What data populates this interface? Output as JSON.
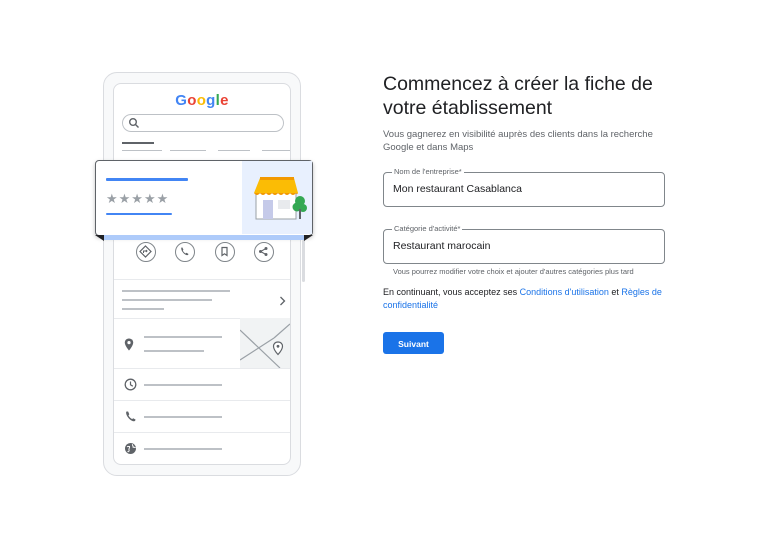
{
  "illustration": {
    "logo_letters": [
      {
        "char": "G",
        "color": "#4285f4"
      },
      {
        "char": "o",
        "color": "#ea4335"
      },
      {
        "char": "o",
        "color": "#fbbc05"
      },
      {
        "char": "g",
        "color": "#4285f4"
      },
      {
        "char": "l",
        "color": "#34a853"
      },
      {
        "char": "e",
        "color": "#ea4335"
      }
    ],
    "stars": "★★★★★",
    "icons": [
      "search-icon",
      "directions-icon",
      "phone-icon",
      "bookmark-icon",
      "share-icon",
      "chevron-right-icon",
      "location-pin-icon",
      "clock-icon",
      "phone-icon",
      "globe-icon",
      "storefront-icon"
    ]
  },
  "form": {
    "title": "Commencez à créer la fiche de votre établissement",
    "subtitle": "Vous gagnerez en visibilité auprès des clients dans la recherche Google et dans Maps",
    "business_name": {
      "label": "Nom de l'entreprise*",
      "value": "Mon restaurant Casablanca"
    },
    "category": {
      "label": "Catégorie d'activité*",
      "value": "Restaurant marocain"
    },
    "category_helper": "Vous pourrez modifier votre choix et ajouter d'autres catégories plus tard",
    "consent": {
      "prefix": "En continuant, vous acceptez ses ",
      "terms_link": "Conditions d'utilisation",
      "and": " et ",
      "privacy_link": "Règles de confidentialité"
    },
    "next_button": "Suivant"
  },
  "colors": {
    "accent": "#1a73e8",
    "card_accent": "#4285f4",
    "awning": "#fbbc05"
  }
}
